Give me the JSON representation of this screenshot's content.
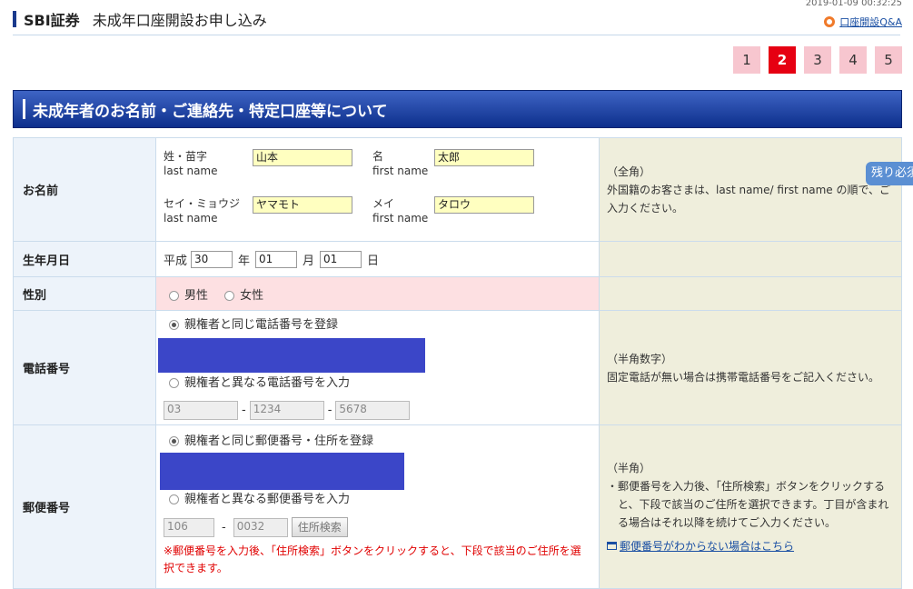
{
  "header": {
    "brand": "SBI証券",
    "title": "未成年口座開設お申し込み",
    "timestamp": "2019-01-09 00:32:25",
    "faq_link": "口座開設Q&A"
  },
  "steps": [
    "1",
    "2",
    "3",
    "4",
    "5"
  ],
  "active_step": "2",
  "section_title": "未成年者のお名前・ご連絡先・特定口座等について",
  "side_tab": "残り必須",
  "rows": {
    "name": {
      "label": "お名前",
      "sei_label": "姓・苗字",
      "sei_sub": "last name",
      "sei_value": "山本",
      "mei_label": "名",
      "mei_sub": "first name",
      "mei_value": "太郎",
      "sei_kana_label": "セイ・ミョウジ",
      "sei_kana_sub": "last name",
      "sei_kana_value": "ヤマモト",
      "mei_kana_label": "メイ",
      "mei_kana_sub": "first name",
      "mei_kana_value": "タロウ",
      "note_title": "（全角）",
      "note_body": "外国籍のお客さまは、last name/ first name の順で、ご入力ください。"
    },
    "birth": {
      "label": "生年月日",
      "era": "平成",
      "year": "30",
      "year_unit": "年",
      "month": "01",
      "month_unit": "月",
      "day": "01",
      "day_unit": "日"
    },
    "gender": {
      "label": "性別",
      "male": "男性",
      "female": "女性"
    },
    "phone": {
      "label": "電話番号",
      "option_same": "親権者と同じ電話番号を登録",
      "option_diff": "親権者と異なる電話番号を入力",
      "part1": "03",
      "part2": "1234",
      "part3": "5678",
      "dash": "-",
      "note_title": "（半角数字）",
      "note_body": "固定電話が無い場合は携帯電話番号をご記入ください。"
    },
    "postal": {
      "label": "郵便番号",
      "option_same": "親権者と同じ郵便番号・住所を登録",
      "option_diff": "親権者と異なる郵便番号を入力",
      "part1": "106",
      "part2": "0032",
      "dash": "-",
      "search_button": "住所検索",
      "warning": "※郵便番号を入力後、「住所検索」ボタンをクリックすると、下段で該当のご住所を選択できます。",
      "note_title": "（半角）",
      "note_bullet": "・",
      "note_body": "郵便番号を入力後、「住所検索」ボタンをクリックすると、下段で該当のご住所を選択できます。丁目が含まれる場合はそれ以降を続けてご入力ください。",
      "note_link": "郵便番号がわからない場合はこちら"
    }
  }
}
